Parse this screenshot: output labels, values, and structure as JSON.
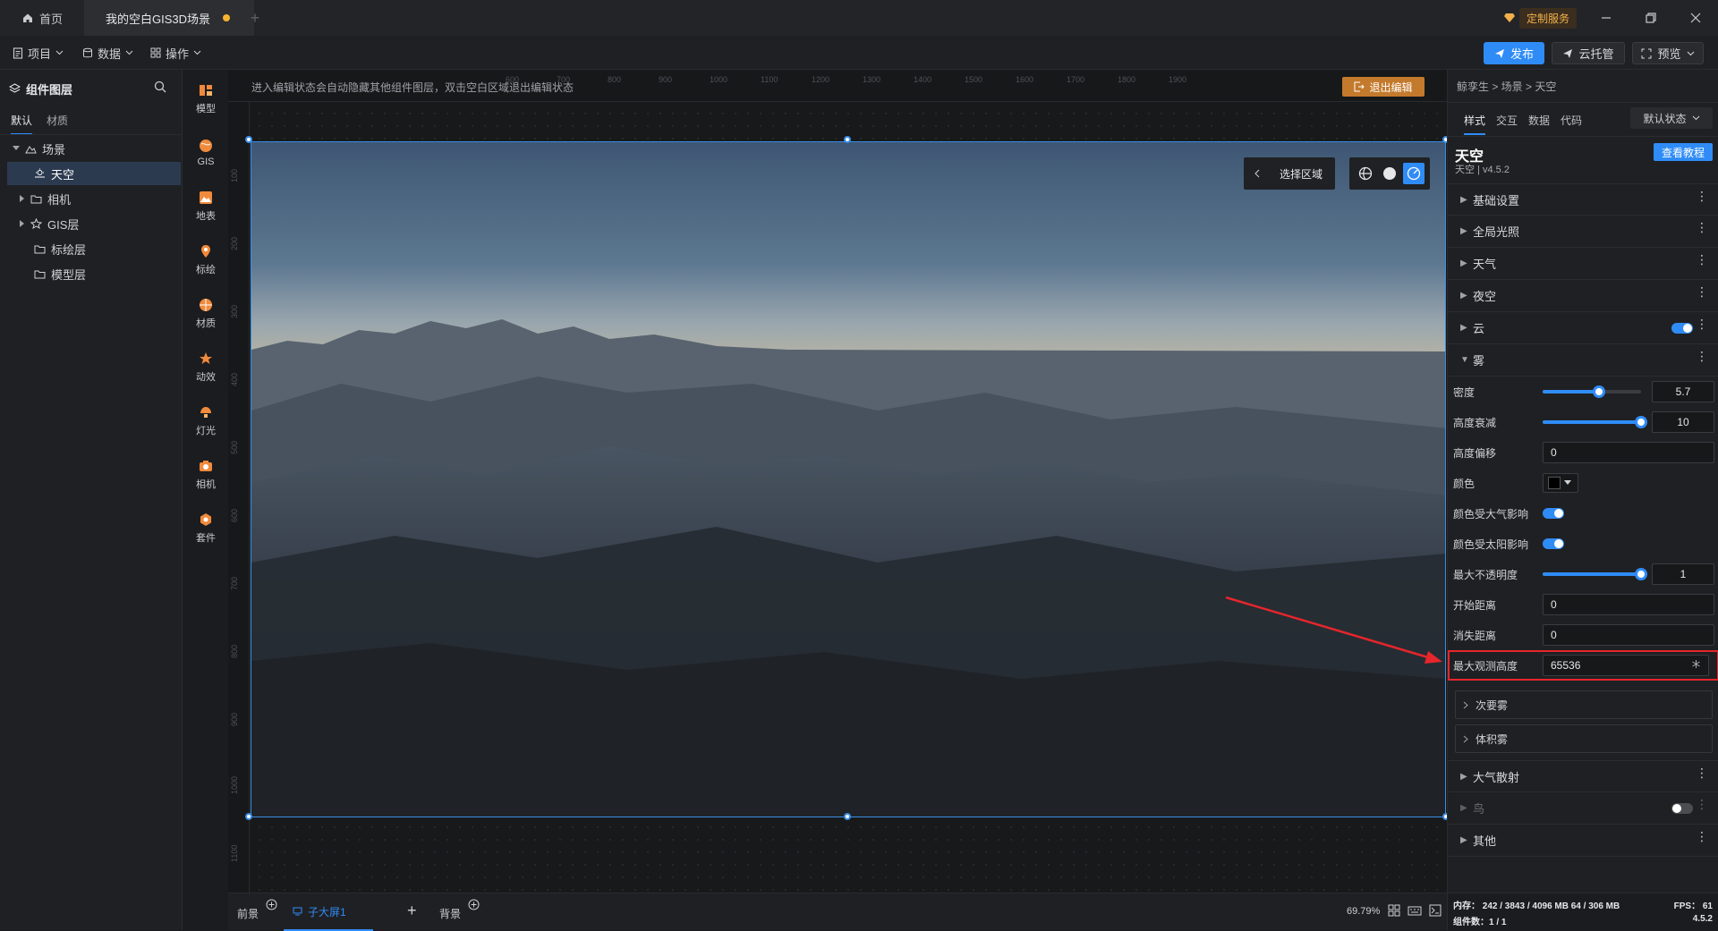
{
  "tabs": {
    "home": "首页",
    "scene": "我的空白GIS3D场景"
  },
  "custom_service": "定制服务",
  "menu": {
    "project": "项目",
    "data": "数据",
    "operation": "操作"
  },
  "toolbar": {
    "publish": "发布",
    "cloud": "云托管",
    "preview": "预览"
  },
  "layers": {
    "title": "组件图层",
    "tabs": [
      "默认",
      "材质"
    ],
    "tree": [
      {
        "label": "场景",
        "icon": "scene-icon"
      },
      {
        "label": "天空",
        "icon": "sky-icon"
      },
      {
        "label": "相机",
        "icon": "folder-icon"
      },
      {
        "label": "GIS层",
        "icon": "gis-layer-icon"
      },
      {
        "label": "标绘层",
        "icon": "folder-icon"
      },
      {
        "label": "模型层",
        "icon": "folder-icon"
      }
    ]
  },
  "tools": [
    "模型",
    "GIS",
    "地表",
    "标绘",
    "材质",
    "动效",
    "灯光",
    "相机",
    "套件"
  ],
  "canvas": {
    "hint": "进入编辑状态会自动隐藏其他组件图层，双击空白区域退出编辑状态",
    "exit_edit": "退出编辑",
    "select_area": "选择区域",
    "ruler_top": [
      "600",
      "700",
      "800",
      "900",
      "1000",
      "1100",
      "1200",
      "1300",
      "1400",
      "1500",
      "1600",
      "1700",
      "1800",
      "1900"
    ],
    "ruler_left": [
      "100",
      "200",
      "300",
      "400",
      "500",
      "600",
      "700",
      "800",
      "900",
      "1000",
      "1100"
    ]
  },
  "bottom": {
    "front": "前景",
    "screen": "子大屏1",
    "background": "背景",
    "zoom": "69.79%"
  },
  "props": {
    "breadcrumb": "鲸孪生 > 场景 > 天空",
    "tabs": [
      "样式",
      "交互",
      "数据",
      "代码"
    ],
    "state": "默认状态",
    "title": "天空",
    "subtitle": "天空 | v4.5.2",
    "tutorial": "查看教程",
    "sections_top": [
      "基础设置",
      "全局光照",
      "天气",
      "夜空",
      "云",
      "雾"
    ],
    "fog": {
      "density_label": "密度",
      "density": "5.7",
      "density_pct": 0.57,
      "height_falloff_label": "高度衰减",
      "height_falloff": "10",
      "height_falloff_pct": 1.0,
      "height_offset_label": "高度偏移",
      "height_offset": "0",
      "color_label": "颜色",
      "color": "#000000",
      "atmos_label": "颜色受大气影响",
      "sun_label": "颜色受太阳影响",
      "max_opacity_label": "最大不透明度",
      "max_opacity": "1",
      "max_opacity_pct": 1.0,
      "start_label": "开始距离",
      "start": "0",
      "vanish_label": "消失距离",
      "vanish": "0",
      "max_height_label": "最大观测高度",
      "max_height": "65536"
    },
    "subsections": [
      "次要雾",
      "体积雾"
    ],
    "sections_bottom": [
      "大气散射",
      "鸟",
      "其他"
    ]
  },
  "status": {
    "memory": "内存： 242 / 3843 / 4096 MB  64 / 306 MB",
    "fps": "FPS：  61",
    "components": "组件数：1 / 1",
    "version": "4.5.2"
  },
  "colors": {
    "accent": "#2f8cf7",
    "highlight": "#e5262c",
    "exit": "#c47a2c"
  }
}
